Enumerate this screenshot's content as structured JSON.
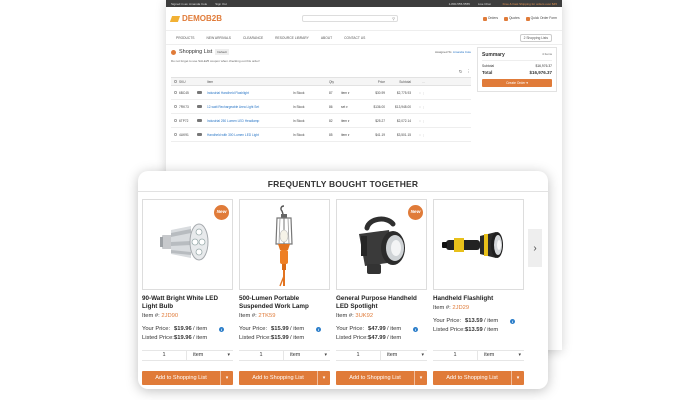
{
  "app": {
    "topbar": {
      "signed_in": "Signed in as: Amanda Cole",
      "user_menu": "Sign Out",
      "phone": "1-800-555-5555",
      "live_chat": "Live Chat",
      "promo": "Free & Fast Shipping for orders over $45"
    },
    "logo": {
      "a": "DEMO",
      "b": "B2B"
    },
    "search_icon": "search-icon",
    "header_links": [
      "Orders",
      "Quotes",
      "Quick Order Form"
    ],
    "nav": [
      "PRODUCTS",
      "NEW ARRIVALS",
      "CLEARANCE",
      "RESOURCE LIBRARY",
      "ABOUT",
      "CONTACT US"
    ],
    "cart_label": "2 Shopping Lists",
    "list": {
      "title": "Shopping List",
      "default_badge": "Default",
      "assigned_label": "Assigned To:",
      "assigned_to": "Amanda Cole",
      "note": "Do not forget to use SALE25 coupon when checking out this order!"
    },
    "table_headers": [
      "SKU",
      "Item",
      "Qty",
      "Price",
      "Subtotal"
    ],
    "rows": [
      {
        "sku": "6BC45",
        "name": "Industrial Handheld Flashlight",
        "stock": "In Stock",
        "qty": "87",
        "unit": "item",
        "price": "$30.99",
        "subtotal": "$2,775.93"
      },
      {
        "sku": "7RK73",
        "name": "12-watt Rechargeable Area Light Set",
        "stock": "In Stock",
        "qty": "86",
        "unit": "set",
        "price": "$136.00",
        "subtotal": "$13,948.00"
      },
      {
        "sku": "6TP72",
        "name": "Industrial 250 Lumen LED Headlamp",
        "stock": "In Stock",
        "qty": "82",
        "unit": "item",
        "price": "$25.27",
        "subtotal": "$2,072.14"
      },
      {
        "sku": "4UK91",
        "name": "Handheld with 300 Lumen LED Light",
        "stock": "In Stock",
        "qty": "85",
        "unit": "item",
        "price": "$41.19",
        "subtotal": "$3,501.15"
      }
    ],
    "summary": {
      "title": "Summary",
      "items": "4 Items",
      "subtotal_label": "Subtotal",
      "subtotal": "$16,976.37",
      "total_label": "Total",
      "total": "$16,976.37",
      "create_order": "Create Order"
    }
  },
  "fbt": {
    "title": "FREQUENTLY BOUGHT TOGETHER",
    "your_price_label": "Your Price:",
    "listed_price_label": "Listed Price:",
    "per": "/ item",
    "item_label": "Item #:",
    "new_label": "New",
    "add_label": "Add to Shopping List",
    "products": [
      {
        "name": "90-Watt Bright White LED Light Bulb",
        "item": "2JD90",
        "your_price": "$19.96",
        "listed_price": "$19.96",
        "qty": "1",
        "unit": "item",
        "is_new": true
      },
      {
        "name": "500-Lumen Portable Suspended Work Lamp",
        "item": "2TK59",
        "your_price": "$15.99",
        "listed_price": "$15.99",
        "qty": "1",
        "unit": "item",
        "is_new": false
      },
      {
        "name": "General Purpose Handheld LED Spotlight",
        "item": "3UK92",
        "your_price": "$47.99",
        "listed_price": "$47.99",
        "qty": "1",
        "unit": "item",
        "is_new": true
      },
      {
        "name": "Handheld Flashlight",
        "item": "2JD29",
        "your_price": "$13.59",
        "listed_price": "$13.59",
        "qty": "1",
        "unit": "item",
        "is_new": false
      }
    ]
  },
  "colors": {
    "accent": "#e07b39",
    "link": "#2a76c6",
    "info": "#2a7dc9"
  },
  "icons": {
    "next": "chevron-right-icon",
    "dropdown": "chevron-down-icon",
    "info": "info-icon"
  }
}
